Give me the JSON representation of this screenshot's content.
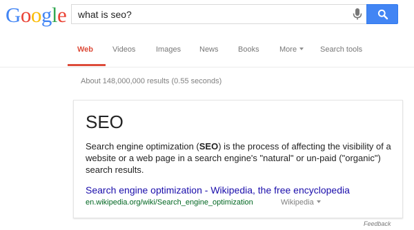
{
  "logo": {
    "letters": [
      "G",
      "o",
      "o",
      "g",
      "l",
      "e"
    ]
  },
  "search": {
    "query": "what is seo?"
  },
  "tabs": [
    {
      "label": "Web",
      "active": true
    },
    {
      "label": "Videos"
    },
    {
      "label": "Images"
    },
    {
      "label": "News"
    },
    {
      "label": "Books"
    },
    {
      "label": "More",
      "has_dropdown": true
    },
    {
      "label": "Search tools"
    }
  ],
  "result_stats": "About 148,000,000 results (0.55 seconds)",
  "answer_card": {
    "title": "SEO",
    "description_before": "Search engine optimization (",
    "description_bold": "SEO",
    "description_after": ") is the process of affecting the visibility of a website or a web page in a search engine's \"natural\" or un-paid (\"organic\") search results.",
    "link_text": "Search engine optimization - Wikipedia, the free encyclopedia",
    "url": "en.wikipedia.org/wiki/Search_engine_optimization",
    "source": "Wikipedia"
  },
  "footer": {
    "feedback": "Feedback"
  },
  "colors": {
    "accent_blue": "#4285f4",
    "active_tab": "#dd4b39",
    "link": "#1a0dab",
    "url": "#006621"
  },
  "icons": [
    "microphone-icon",
    "magnifier-icon",
    "chevron-down-icon"
  ]
}
